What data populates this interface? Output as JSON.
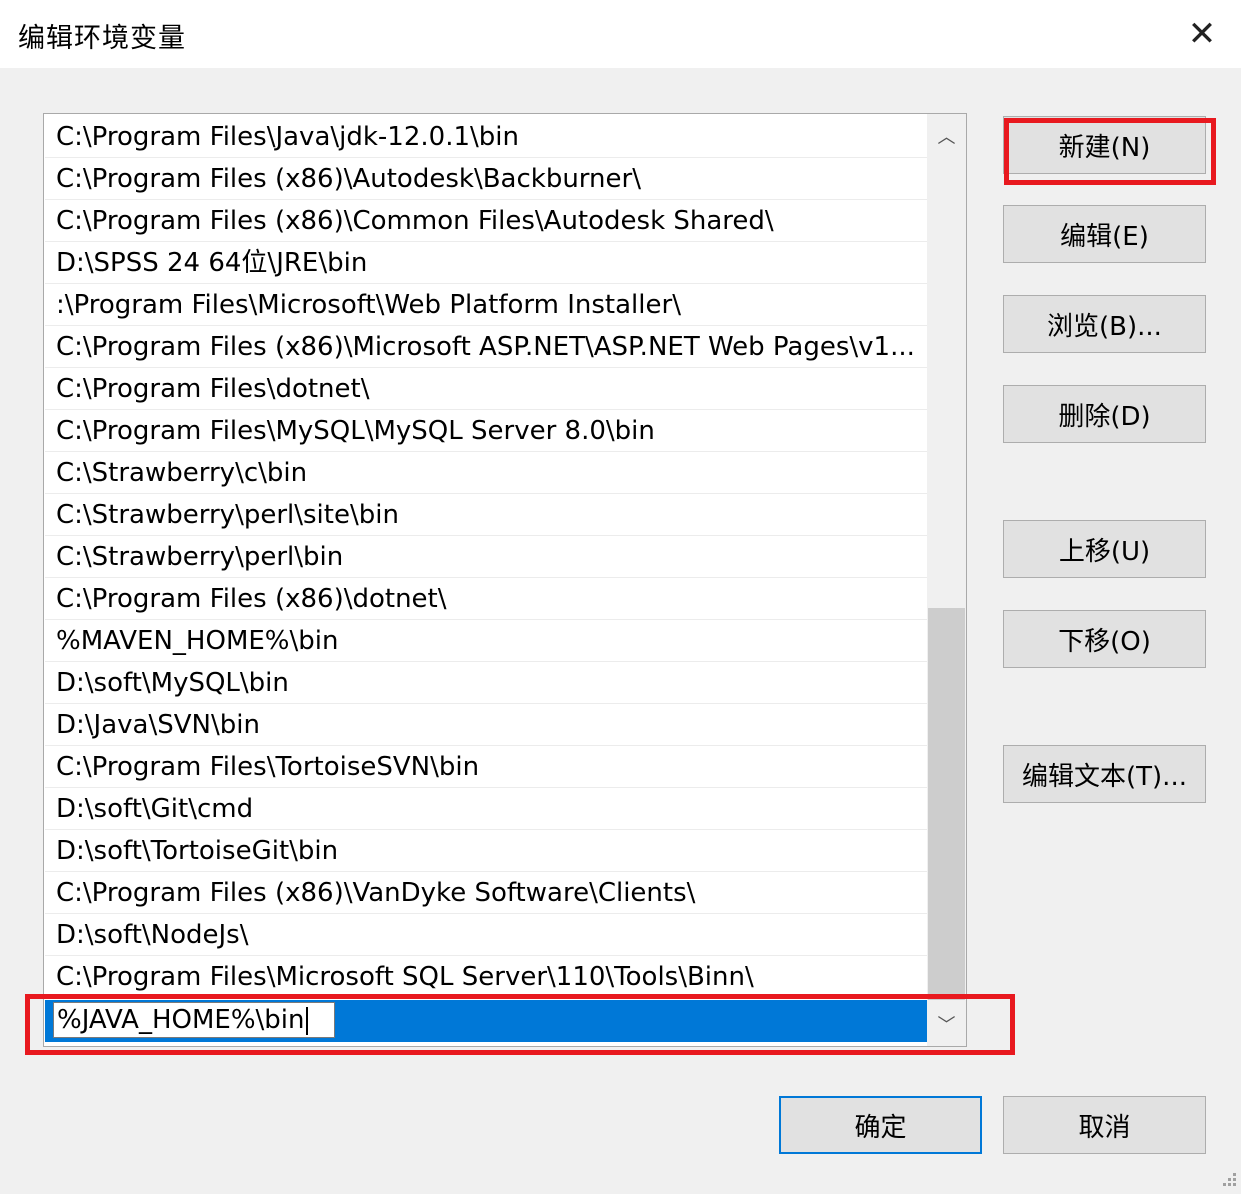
{
  "window": {
    "title": "编辑环境变量",
    "close_glyph": "✕"
  },
  "list": {
    "items": [
      "C:\\Program Files\\Java\\jdk-12.0.1\\bin",
      "C:\\Program Files (x86)\\Autodesk\\Backburner\\",
      "C:\\Program Files (x86)\\Common Files\\Autodesk Shared\\",
      "D:\\SPSS 24 64位\\JRE\\bin",
      ":\\Program Files\\Microsoft\\Web Platform Installer\\",
      "C:\\Program Files (x86)\\Microsoft ASP.NET\\ASP.NET Web Pages\\v1...",
      "C:\\Program Files\\dotnet\\",
      "C:\\Program Files\\MySQL\\MySQL Server 8.0\\bin",
      "C:\\Strawberry\\c\\bin",
      "C:\\Strawberry\\perl\\site\\bin",
      "C:\\Strawberry\\perl\\bin",
      "C:\\Program Files (x86)\\dotnet\\",
      "%MAVEN_HOME%\\bin",
      "D:\\soft\\MySQL\\bin",
      "D:\\Java\\SVN\\bin",
      "C:\\Program Files\\TortoiseSVN\\bin",
      "D:\\soft\\Git\\cmd",
      "D:\\soft\\TortoiseGit\\bin",
      "C:\\Program Files (x86)\\VanDyke Software\\Clients\\",
      "D:\\soft\\NodeJs\\",
      "C:\\Program Files\\Microsoft SQL Server\\110\\Tools\\Binn\\"
    ],
    "editing_value": "%JAVA_HOME%\\bin",
    "scroll_up_glyph": "︿",
    "scroll_down_glyph": "﹀"
  },
  "buttons": {
    "new": "新建(N)",
    "edit": "编辑(E)",
    "browse": "浏览(B)...",
    "delete": "删除(D)",
    "move_up": "上移(U)",
    "move_down": "下移(O)",
    "edit_text": "编辑文本(T)...",
    "ok": "确定",
    "cancel": "取消"
  },
  "colors": {
    "selection": "#0078d7",
    "annotation_red": "#e8191f",
    "button_face": "#e1e1e1",
    "dialog_bg": "#f0f0f0"
  }
}
